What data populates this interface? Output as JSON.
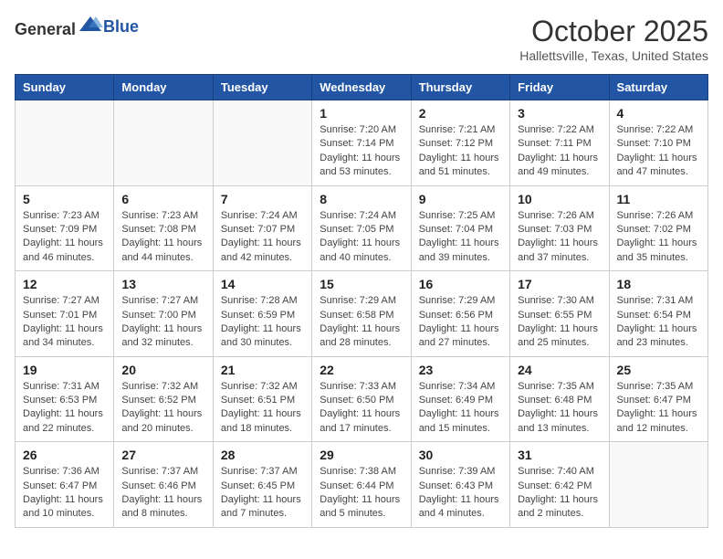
{
  "header": {
    "logo_general": "General",
    "logo_blue": "Blue",
    "month": "October 2025",
    "location": "Hallettsville, Texas, United States"
  },
  "days_of_week": [
    "Sunday",
    "Monday",
    "Tuesday",
    "Wednesday",
    "Thursday",
    "Friday",
    "Saturday"
  ],
  "weeks": [
    [
      {
        "day": "",
        "info": ""
      },
      {
        "day": "",
        "info": ""
      },
      {
        "day": "",
        "info": ""
      },
      {
        "day": "1",
        "info": "Sunrise: 7:20 AM\nSunset: 7:14 PM\nDaylight: 11 hours and 53 minutes."
      },
      {
        "day": "2",
        "info": "Sunrise: 7:21 AM\nSunset: 7:12 PM\nDaylight: 11 hours and 51 minutes."
      },
      {
        "day": "3",
        "info": "Sunrise: 7:22 AM\nSunset: 7:11 PM\nDaylight: 11 hours and 49 minutes."
      },
      {
        "day": "4",
        "info": "Sunrise: 7:22 AM\nSunset: 7:10 PM\nDaylight: 11 hours and 47 minutes."
      }
    ],
    [
      {
        "day": "5",
        "info": "Sunrise: 7:23 AM\nSunset: 7:09 PM\nDaylight: 11 hours and 46 minutes."
      },
      {
        "day": "6",
        "info": "Sunrise: 7:23 AM\nSunset: 7:08 PM\nDaylight: 11 hours and 44 minutes."
      },
      {
        "day": "7",
        "info": "Sunrise: 7:24 AM\nSunset: 7:07 PM\nDaylight: 11 hours and 42 minutes."
      },
      {
        "day": "8",
        "info": "Sunrise: 7:24 AM\nSunset: 7:05 PM\nDaylight: 11 hours and 40 minutes."
      },
      {
        "day": "9",
        "info": "Sunrise: 7:25 AM\nSunset: 7:04 PM\nDaylight: 11 hours and 39 minutes."
      },
      {
        "day": "10",
        "info": "Sunrise: 7:26 AM\nSunset: 7:03 PM\nDaylight: 11 hours and 37 minutes."
      },
      {
        "day": "11",
        "info": "Sunrise: 7:26 AM\nSunset: 7:02 PM\nDaylight: 11 hours and 35 minutes."
      }
    ],
    [
      {
        "day": "12",
        "info": "Sunrise: 7:27 AM\nSunset: 7:01 PM\nDaylight: 11 hours and 34 minutes."
      },
      {
        "day": "13",
        "info": "Sunrise: 7:27 AM\nSunset: 7:00 PM\nDaylight: 11 hours and 32 minutes."
      },
      {
        "day": "14",
        "info": "Sunrise: 7:28 AM\nSunset: 6:59 PM\nDaylight: 11 hours and 30 minutes."
      },
      {
        "day": "15",
        "info": "Sunrise: 7:29 AM\nSunset: 6:58 PM\nDaylight: 11 hours and 28 minutes."
      },
      {
        "day": "16",
        "info": "Sunrise: 7:29 AM\nSunset: 6:56 PM\nDaylight: 11 hours and 27 minutes."
      },
      {
        "day": "17",
        "info": "Sunrise: 7:30 AM\nSunset: 6:55 PM\nDaylight: 11 hours and 25 minutes."
      },
      {
        "day": "18",
        "info": "Sunrise: 7:31 AM\nSunset: 6:54 PM\nDaylight: 11 hours and 23 minutes."
      }
    ],
    [
      {
        "day": "19",
        "info": "Sunrise: 7:31 AM\nSunset: 6:53 PM\nDaylight: 11 hours and 22 minutes."
      },
      {
        "day": "20",
        "info": "Sunrise: 7:32 AM\nSunset: 6:52 PM\nDaylight: 11 hours and 20 minutes."
      },
      {
        "day": "21",
        "info": "Sunrise: 7:32 AM\nSunset: 6:51 PM\nDaylight: 11 hours and 18 minutes."
      },
      {
        "day": "22",
        "info": "Sunrise: 7:33 AM\nSunset: 6:50 PM\nDaylight: 11 hours and 17 minutes."
      },
      {
        "day": "23",
        "info": "Sunrise: 7:34 AM\nSunset: 6:49 PM\nDaylight: 11 hours and 15 minutes."
      },
      {
        "day": "24",
        "info": "Sunrise: 7:35 AM\nSunset: 6:48 PM\nDaylight: 11 hours and 13 minutes."
      },
      {
        "day": "25",
        "info": "Sunrise: 7:35 AM\nSunset: 6:47 PM\nDaylight: 11 hours and 12 minutes."
      }
    ],
    [
      {
        "day": "26",
        "info": "Sunrise: 7:36 AM\nSunset: 6:47 PM\nDaylight: 11 hours and 10 minutes."
      },
      {
        "day": "27",
        "info": "Sunrise: 7:37 AM\nSunset: 6:46 PM\nDaylight: 11 hours and 8 minutes."
      },
      {
        "day": "28",
        "info": "Sunrise: 7:37 AM\nSunset: 6:45 PM\nDaylight: 11 hours and 7 minutes."
      },
      {
        "day": "29",
        "info": "Sunrise: 7:38 AM\nSunset: 6:44 PM\nDaylight: 11 hours and 5 minutes."
      },
      {
        "day": "30",
        "info": "Sunrise: 7:39 AM\nSunset: 6:43 PM\nDaylight: 11 hours and 4 minutes."
      },
      {
        "day": "31",
        "info": "Sunrise: 7:40 AM\nSunset: 6:42 PM\nDaylight: 11 hours and 2 minutes."
      },
      {
        "day": "",
        "info": ""
      }
    ]
  ]
}
